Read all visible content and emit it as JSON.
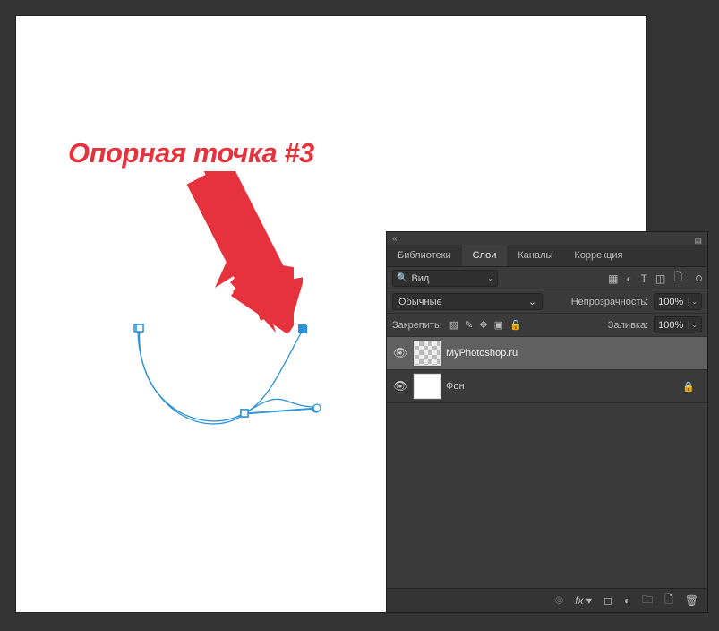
{
  "annotation": {
    "text": "Опорная точка #3",
    "color": "#e6323c"
  },
  "panel": {
    "tabs": [
      {
        "label": "Библиотеки",
        "active": false
      },
      {
        "label": "Слои",
        "active": true
      },
      {
        "label": "Каналы",
        "active": false
      },
      {
        "label": "Коррекция",
        "active": false
      }
    ],
    "search": {
      "label": "Вид"
    },
    "blend": {
      "mode": "Обычные"
    },
    "opacity": {
      "label": "Непрозрачность:",
      "value": "100%"
    },
    "lock": {
      "label": "Закрепить:"
    },
    "fill": {
      "label": "Заливка:",
      "value": "100%"
    },
    "layers": [
      {
        "name": "MyPhotoshop.ru",
        "selected": true,
        "visible": true,
        "thumb": "checker",
        "locked": false
      },
      {
        "name": "Фон",
        "selected": false,
        "visible": true,
        "thumb": "white",
        "locked": true
      }
    ]
  }
}
